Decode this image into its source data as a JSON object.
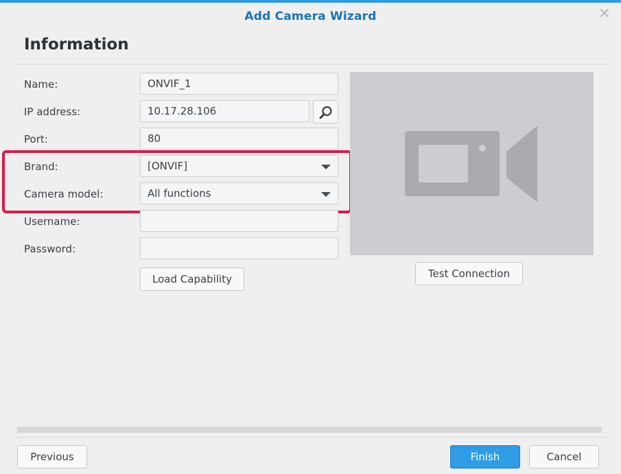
{
  "dialog": {
    "title": "Add Camera Wizard",
    "close_glyph": "✕"
  },
  "section": {
    "title": "Information"
  },
  "form": {
    "name": {
      "label": "Name:",
      "value": "ONVIF_1"
    },
    "ip": {
      "label": "IP address:",
      "value": "10.17.28.106"
    },
    "port": {
      "label": "Port:",
      "value": "80"
    },
    "brand": {
      "label": "Brand:",
      "value": "[ONVIF]"
    },
    "model": {
      "label": "Camera model:",
      "value": "All functions"
    },
    "username": {
      "label": "Username:",
      "value": ""
    },
    "password": {
      "label": "Password:",
      "value": ""
    },
    "load_capability_label": "Load Capability"
  },
  "preview": {
    "icon": "video-camera-icon",
    "test_connection_label": "Test Connection"
  },
  "footer": {
    "previous_label": "Previous",
    "finish_label": "Finish",
    "cancel_label": "Cancel"
  },
  "colors": {
    "accent": "#2f9ce5",
    "title_blue": "#1a73b8",
    "highlight_red": "#d81b47",
    "preview_bg": "#cbcdd0"
  }
}
